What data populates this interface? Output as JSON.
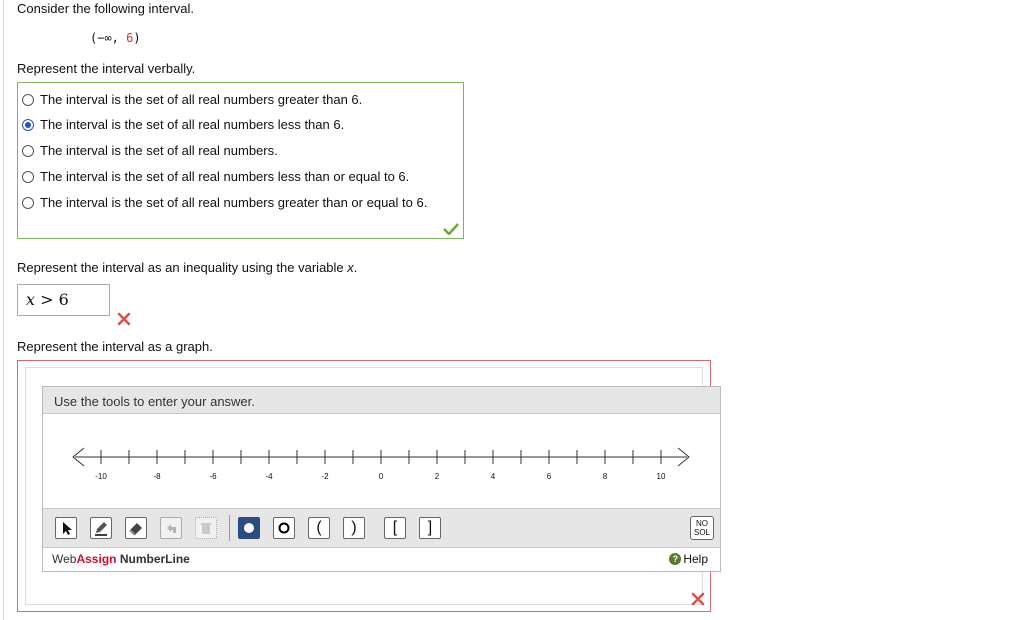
{
  "question": {
    "intro": "Consider the following interval.",
    "interval_prefix": "(−∞, ",
    "interval_value": "6",
    "interval_suffix": ")"
  },
  "part1": {
    "prompt": "Represent the interval verbally.",
    "choices": [
      {
        "label": "The interval is the set of all real numbers greater than 6.",
        "selected": false
      },
      {
        "label": "The interval is the set of all real numbers less than 6.",
        "selected": true
      },
      {
        "label": "The interval is the set of all real numbers.",
        "selected": false
      },
      {
        "label": "The interval is the set of all real numbers less than or equal to 6.",
        "selected": false
      },
      {
        "label": "The interval is the set of all real numbers greater than or equal to 6.",
        "selected": false
      }
    ],
    "status": "correct"
  },
  "part2": {
    "prompt_prefix": "Represent the interval as an inequality using the variable ",
    "prompt_var": "x",
    "prompt_suffix": ".",
    "answer_var": "x",
    "answer_op": " > ",
    "answer_val": "6",
    "status": "incorrect"
  },
  "part3": {
    "prompt": "Represent the interval as a graph.",
    "tool_header": "Use the tools to enter your answer.",
    "tick_labels": [
      "-10",
      "-8",
      "-6",
      "-4",
      "-2",
      "0",
      "2",
      "4",
      "6",
      "8",
      "10"
    ],
    "tools": [
      {
        "name": "pointer-tool",
        "label": ""
      },
      {
        "name": "pencil-tool",
        "label": ""
      },
      {
        "name": "eraser-tool",
        "label": ""
      },
      {
        "name": "undo-tool",
        "label": ""
      },
      {
        "name": "trash-tool",
        "label": ""
      },
      {
        "name": "closed-dot-tool",
        "label": ""
      },
      {
        "name": "open-dot-tool",
        "label": ""
      },
      {
        "name": "left-paren-tool",
        "label": "("
      },
      {
        "name": "right-paren-tool",
        "label": ")"
      },
      {
        "name": "left-bracket-tool",
        "label": "["
      },
      {
        "name": "right-bracket-tool",
        "label": "]"
      }
    ],
    "no_solution": {
      "line1": "NO",
      "line2": "SOL"
    },
    "brand_web": "Web",
    "brand_assign": "Assign",
    "brand_product": " NumberLine",
    "help_label": "Help",
    "status": "incorrect"
  },
  "colors": {
    "correct_border": "#7cb65a",
    "incorrect_border": "#d46a6a",
    "selected_radio": "#1a56c9",
    "checkmark": "#6aaa3a",
    "xmark": "#d9534f"
  }
}
